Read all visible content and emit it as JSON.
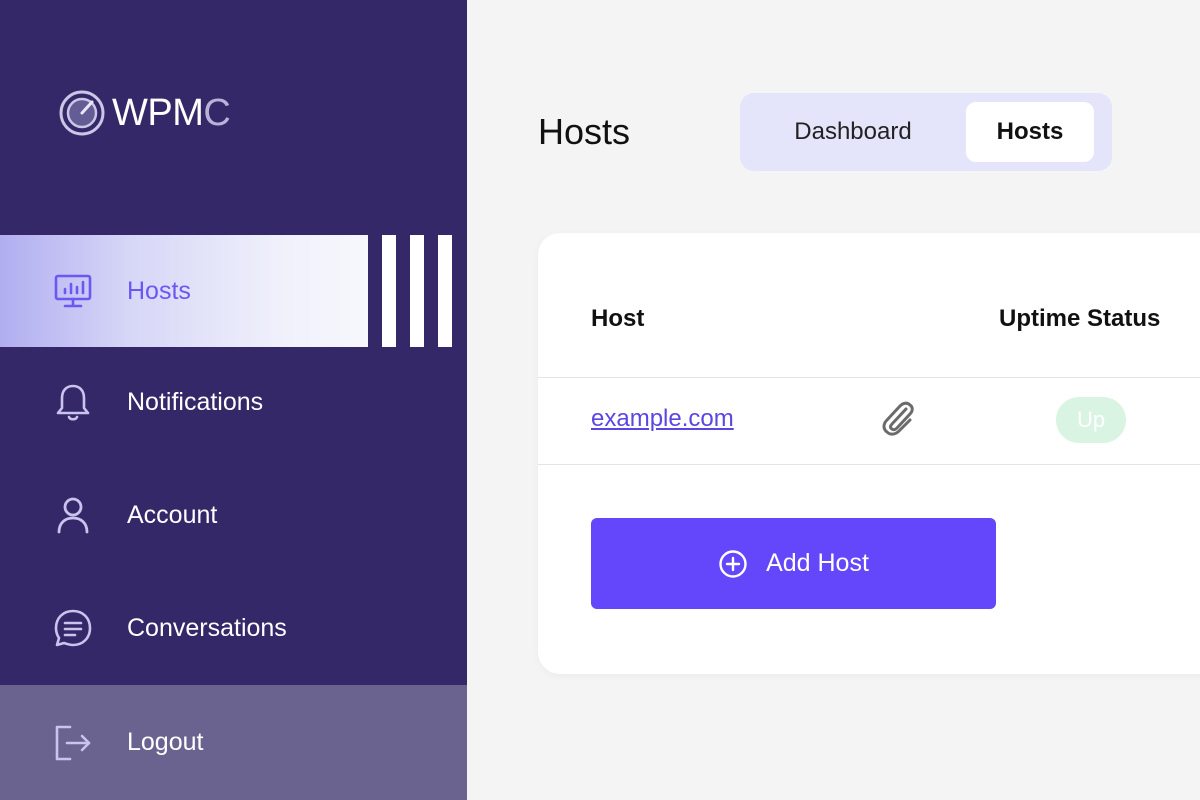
{
  "app": {
    "logo_main": "WPM",
    "logo_last": "C"
  },
  "sidebar": {
    "items": [
      {
        "label": "Hosts",
        "icon": "monitor-chart-icon",
        "active": true
      },
      {
        "label": "Notifications",
        "icon": "bell-icon"
      },
      {
        "label": "Account",
        "icon": "user-icon"
      },
      {
        "label": "Conversations",
        "icon": "chat-icon"
      },
      {
        "label": "Logout",
        "icon": "logout-icon"
      }
    ]
  },
  "main": {
    "title": "Hosts",
    "tabs": [
      {
        "label": "Dashboard",
        "active": false
      },
      {
        "label": "Hosts",
        "active": true
      }
    ],
    "table": {
      "columns": [
        "Host",
        "Uptime Status"
      ],
      "rows": [
        {
          "host": "example.com",
          "status": "Up"
        }
      ]
    },
    "add_button_label": "Add Host"
  },
  "colors": {
    "sidebar_bg": "#352868",
    "accent": "#6447fb",
    "status_up": "#d9f4e3",
    "logout_bg": "#6b638f"
  }
}
